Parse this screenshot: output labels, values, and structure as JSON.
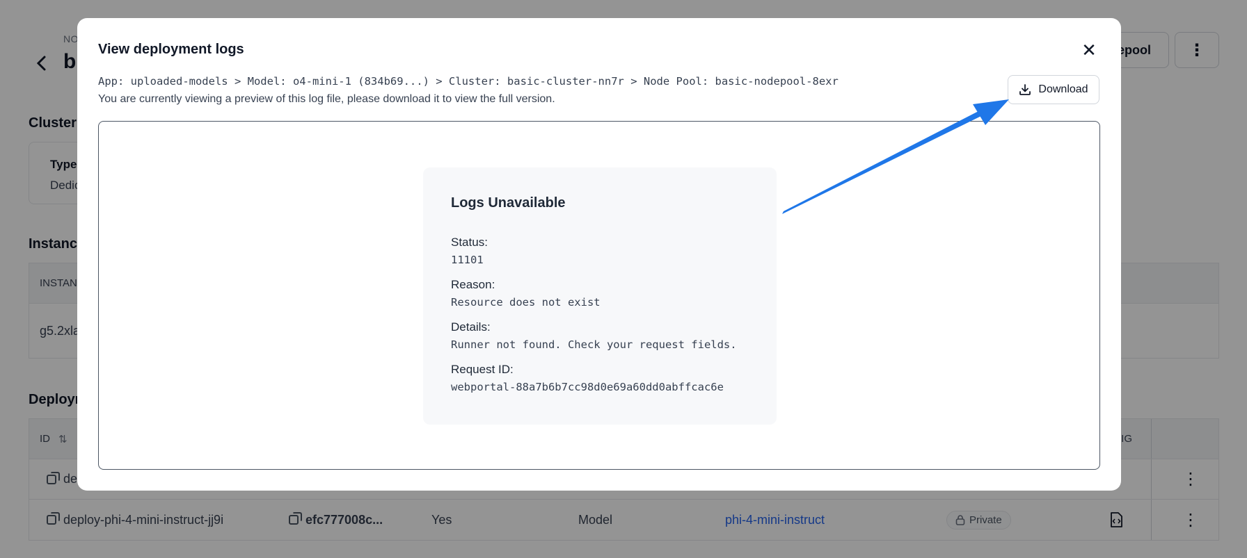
{
  "background": {
    "breadcrumb_prefix": "NO",
    "page_title": "b",
    "nodepool_button_label": "epool",
    "more_button_label": "⋮",
    "cluster_section_title": "Cluster",
    "cluster_card": {
      "type_label": "Type",
      "type_value": "Dedic"
    },
    "instances_section_title": "Instance",
    "instances_table": {
      "header_label": "INSTAN",
      "row_value": "g5.2xla"
    },
    "deployments_section_title": "Deploym",
    "deployments_table": {
      "id_header": "ID",
      "sort_icon_glyph": "⇅",
      "config_header_partial": "FIG",
      "rows": [
        {
          "id": "de",
          "kebab": "⋮"
        },
        {
          "id": "deploy-phi-4-mini-instruct-jj9i",
          "hash": "efc777008c...",
          "enabled": "Yes",
          "type": "Model",
          "model_link": "phi-4-mini-instruct",
          "visibility": "Private",
          "kebab": "⋮"
        }
      ]
    }
  },
  "modal": {
    "title": "View deployment logs",
    "close_glyph": "✕",
    "path": "App: uploaded-models > Model: o4-mini-1 (834b69...) > Cluster: basic-cluster-nn7r > Node Pool: basic-nodepool-8exr",
    "preview_note": "You are currently viewing a preview of this log file, please download it to view the full version.",
    "download_label": "Download",
    "error": {
      "heading": "Logs Unavailable",
      "status_label": "Status:",
      "status_value": "11101",
      "reason_label": "Reason:",
      "reason_value": "Resource does not exist",
      "details_label": "Details:",
      "details_value": "Runner not found. Check your request fields.",
      "request_id_label": "Request ID:",
      "request_id_value": "webportal-88a7b6b7cc98d0e69a60dd0abffcac6e"
    }
  },
  "icons": {
    "back": "chevron-left-icon",
    "close": "close-icon",
    "download": "download-icon",
    "copy": "copy-icon",
    "lock": "lock-icon",
    "code": "code-file-icon",
    "kebab": "kebab-menu-icon",
    "annotation": "annotation-arrow"
  },
  "colors": {
    "overlay": "#000000",
    "annotation_arrow": "#1f77e8",
    "link": "#2563eb"
  }
}
